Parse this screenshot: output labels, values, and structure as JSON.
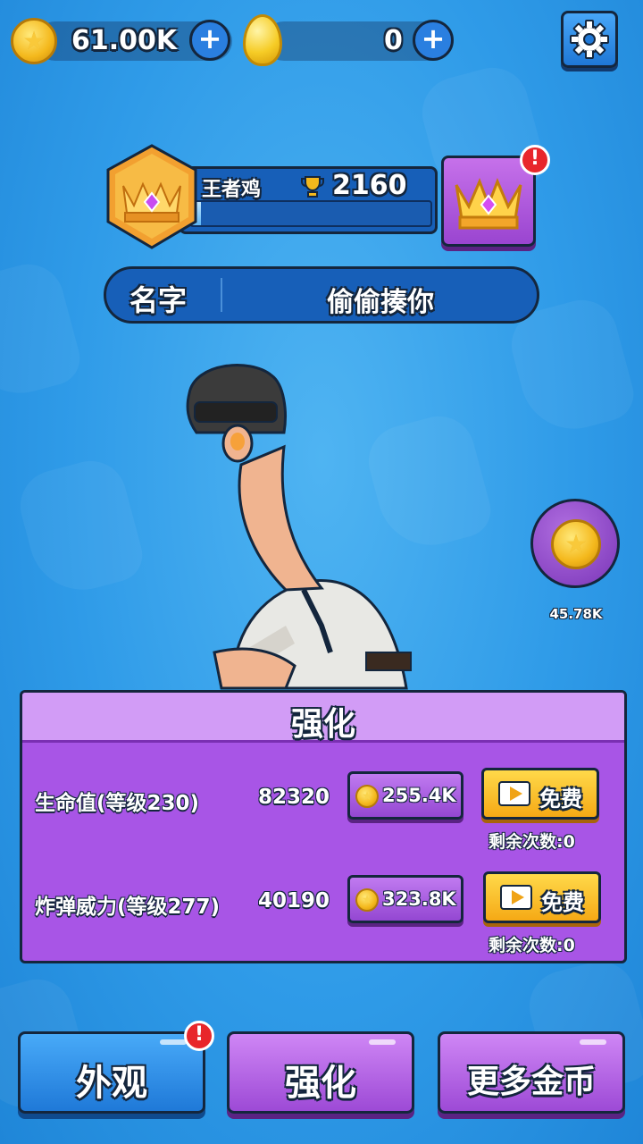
{
  "currency": {
    "coins": "61.00K",
    "eggs": "0"
  },
  "rank": {
    "title": "王者鸡",
    "trophies": "2160",
    "progress": 0.04
  },
  "profile": {
    "name_label": "名字",
    "name_value": "偷偷揍你"
  },
  "reward": {
    "amount": "45.78K"
  },
  "upgrade_panel": {
    "title": "强化",
    "rows": [
      {
        "stat": "生命值(等级230)",
        "value": "82320",
        "cost": "255.4K",
        "free_label": "免费",
        "remaining": "剩余次数:0"
      },
      {
        "stat": "炸弹威力(等级277)",
        "value": "40190",
        "cost": "323.8K",
        "free_label": "免费",
        "remaining": "剩余次数:0"
      }
    ]
  },
  "tabs": {
    "appearance": "外观",
    "upgrade": "强化",
    "more_coins": "更多金币"
  },
  "colors": {
    "background": "#2f9be8",
    "panel_purple": "#a855e6",
    "button_blue": "#1f79d8",
    "button_yellow": "#f5a915",
    "alert_red": "#e8262b"
  }
}
